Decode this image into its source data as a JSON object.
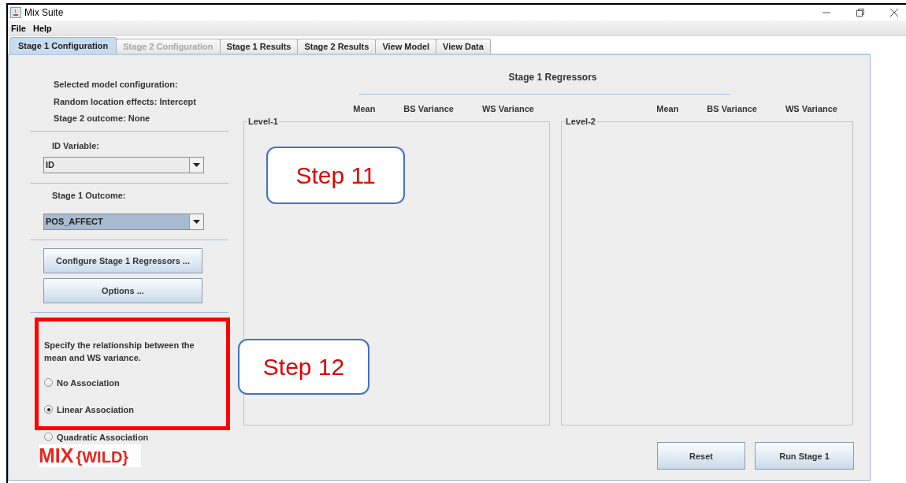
{
  "window": {
    "title": "Mix Suite"
  },
  "menu": [
    "File",
    "Help"
  ],
  "tabs": [
    {
      "label": "Stage 1 Configuration",
      "selected": true,
      "disabled": false
    },
    {
      "label": "Stage 2 Configuration",
      "selected": false,
      "disabled": true
    },
    {
      "label": "Stage 1 Results",
      "selected": false,
      "disabled": false
    },
    {
      "label": "Stage 2 Results",
      "selected": false,
      "disabled": false
    },
    {
      "label": "View Model",
      "selected": false,
      "disabled": false
    },
    {
      "label": "View Data",
      "selected": false,
      "disabled": false
    }
  ],
  "model_summary": [
    "Selected model configuration:",
    "Random location effects: Intercept",
    "Stage 2 outcome: None"
  ],
  "id_variable": {
    "label": "ID Variable:",
    "value": "ID",
    "highlighted": false
  },
  "stage1_outcome": {
    "label": "Stage 1 Outcome:",
    "value": "POS_AFFECT",
    "highlighted": true
  },
  "side_buttons": [
    "Configure Stage 1 Regressors ...",
    "Options ..."
  ],
  "association": {
    "prompt": "Specify the relationship between the mean and WS variance.",
    "highlighted": true,
    "options": [
      {
        "label": "No Association",
        "selected": false
      },
      {
        "label": "Linear Association",
        "selected": true
      },
      {
        "label": "Quadratic Association",
        "selected": false
      }
    ]
  },
  "logo": {
    "text": "MIX",
    "bracketed": "{WILD}"
  },
  "regressors": {
    "title": "Stage 1 Regressors",
    "groups": [
      {
        "title": "Level-1",
        "columns": [
          "Mean",
          "BS Variance",
          "WS Variance"
        ]
      },
      {
        "title": "Level-2",
        "columns": [
          "Mean",
          "BS Variance",
          "WS Variance"
        ]
      }
    ]
  },
  "actions": [
    "Reset",
    "Run Stage 1"
  ],
  "annotations": [
    {
      "text": "Step 11"
    },
    {
      "text": "Step 12"
    }
  ]
}
